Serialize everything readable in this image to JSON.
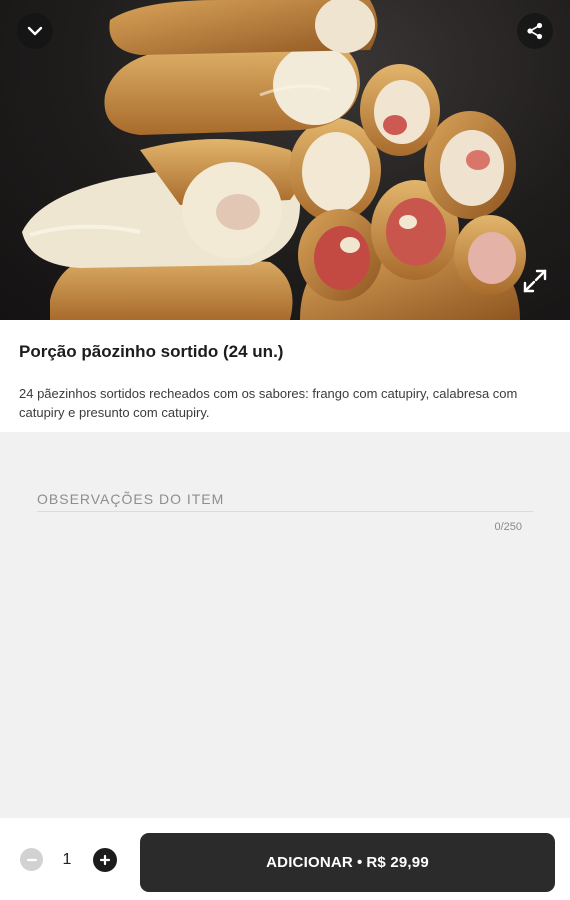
{
  "product": {
    "title": "Porção pãozinho sortido (24 un.)",
    "description": "24 pãezinhos sortidos recheados com os sabores: frango com catupiry, calabresa com catupiry e presunto com catupiry.",
    "image_alt": "Porção de pãezinhos sortidos"
  },
  "hero": {
    "back_icon": "chevron-down-icon",
    "share_icon": "share-icon",
    "expand_icon": "expand-icon"
  },
  "notes": {
    "placeholder": "OBSERVAÇÕES DO ITEM",
    "value": "",
    "counter": "0/250"
  },
  "footer": {
    "quantity": "1",
    "add_label": "ADICIONAR",
    "separator": "•",
    "price": "R$ 29,99"
  },
  "colors": {
    "primary": "#2b2b2b",
    "background": "#f1f1f1",
    "surface": "#ffffff"
  }
}
